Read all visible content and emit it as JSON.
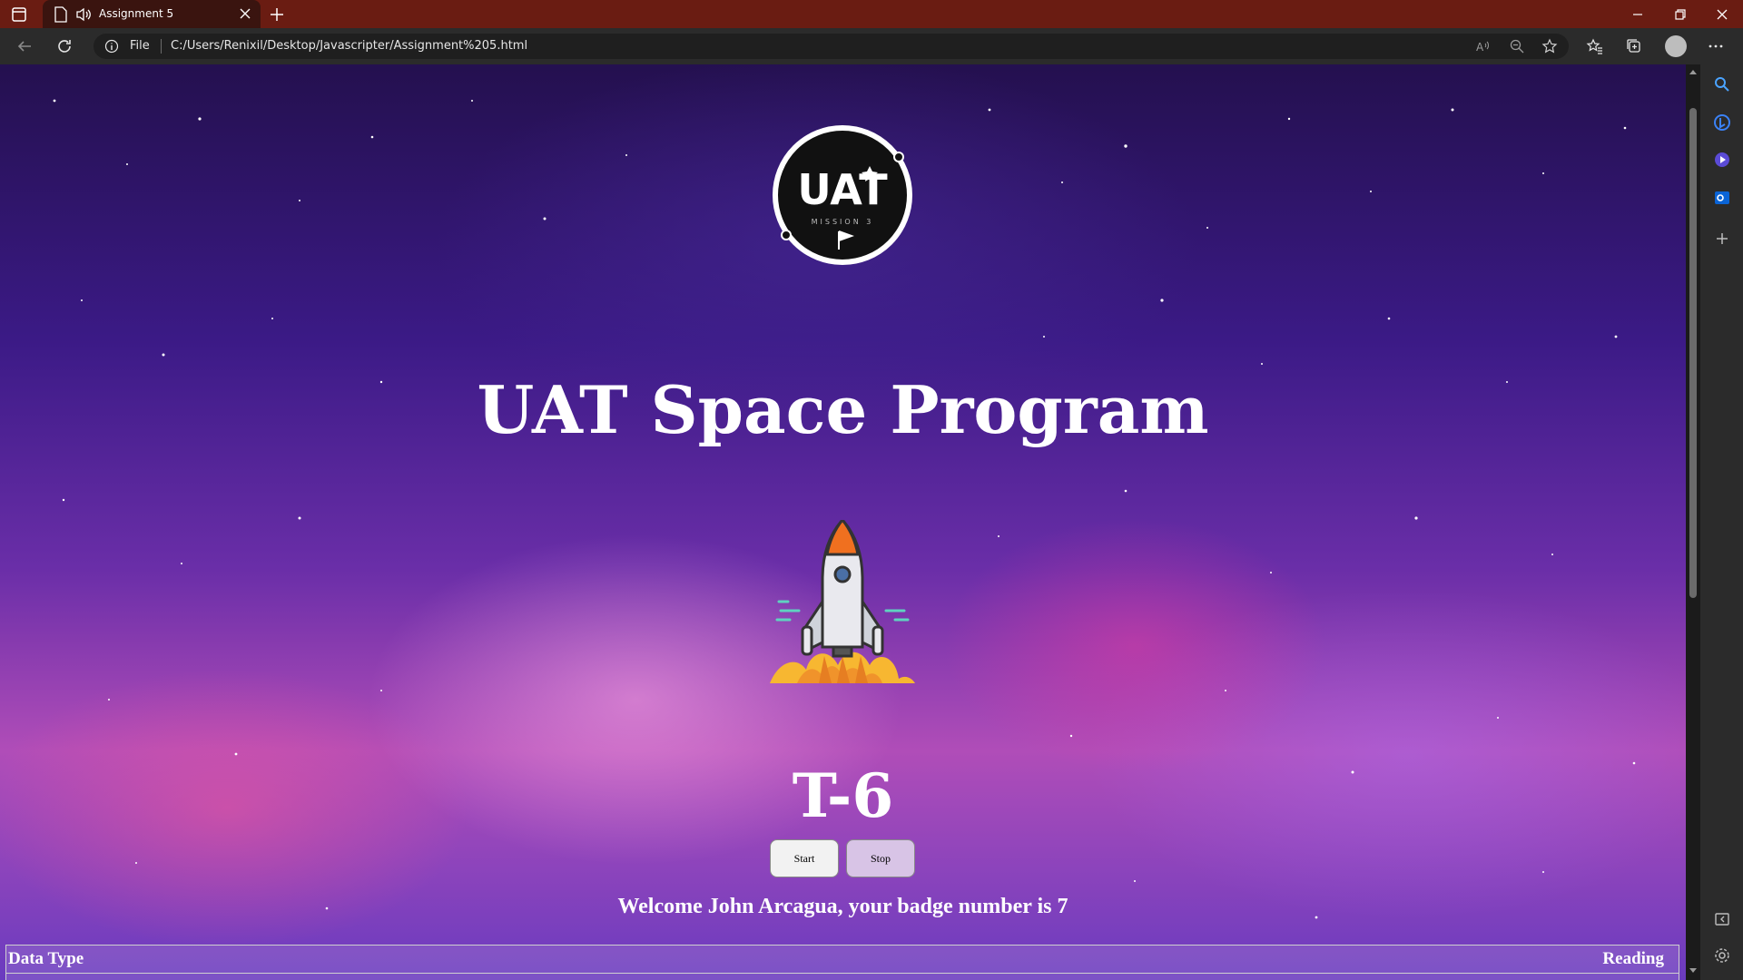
{
  "browser": {
    "tab_title": "Assignment 5",
    "address_scheme_label": "File",
    "url": "C:/Users/Renixil/Desktop/Javascripter/Assignment%205.html"
  },
  "page": {
    "logo_text": "UAT",
    "logo_subtext": "MISSION 3",
    "title": "UAT Space Program",
    "countdown": "T-6",
    "start_label": "Start",
    "stop_label": "Stop",
    "welcome": "Welcome John Arcagua, your badge number is 7",
    "table": {
      "headers": [
        "Data Type",
        "Reading"
      ]
    }
  },
  "icons": {
    "tab_actions": "tab-actions-icon",
    "page": "page-icon",
    "audio": "speaker-icon",
    "close": "close-icon",
    "new_tab": "plus-icon",
    "back": "back-arrow-icon",
    "refresh": "refresh-icon",
    "info": "info-icon",
    "read_aloud": "read-aloud-icon",
    "zoom": "zoom-out-icon",
    "add_favorite": "add-favorite-icon",
    "favorites": "favorites-icon",
    "collections": "collections-icon",
    "profile": "profile-avatar",
    "more": "more-icon"
  },
  "colors": {
    "titlebar": "#6a1c12",
    "toolbar": "#2b2b2b",
    "title_text": "#ffffff",
    "stop_button": "#d8c4e6"
  }
}
